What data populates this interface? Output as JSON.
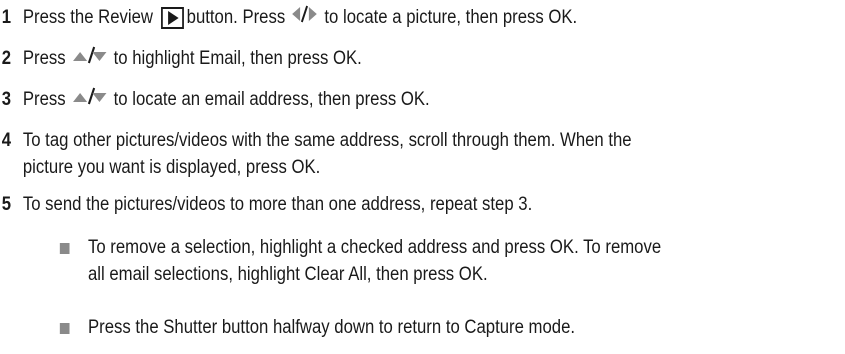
{
  "steps": [
    {
      "number": "1",
      "part_a": "Press the Review",
      "part_b": "button. Press",
      "part_c": "to locate a picture, then press OK."
    },
    {
      "number": "2",
      "part_a": "Press",
      "part_b": "to highlight Email, then press OK."
    },
    {
      "number": "3",
      "part_a": "Press",
      "part_b": "to locate an email address, then press OK."
    },
    {
      "number": "4",
      "line1": "To tag other pictures/videos with the same address, scroll through them. When the",
      "line2": "picture you want is displayed, press OK."
    },
    {
      "number": "5",
      "text": "To send the pictures/videos to more than one address, repeat step 3."
    }
  ],
  "bullets": [
    {
      "line1": "To remove a selection, highlight a checked address and press OK. To remove",
      "line2": "all email selections, highlight Clear All, then press OK."
    },
    {
      "line1": "Press the Shutter button halfway down to return to Capture mode."
    }
  ],
  "icons": {
    "review": "review-play-button-icon",
    "left_right": "left-right-arrows-icon",
    "up_down": "up-down-arrows-icon",
    "bullet": "square-bullet-icon"
  },
  "colors": {
    "text": "#1a1a1a",
    "bullet": "#8a8a8a",
    "arrow": "#7a7a7a"
  }
}
